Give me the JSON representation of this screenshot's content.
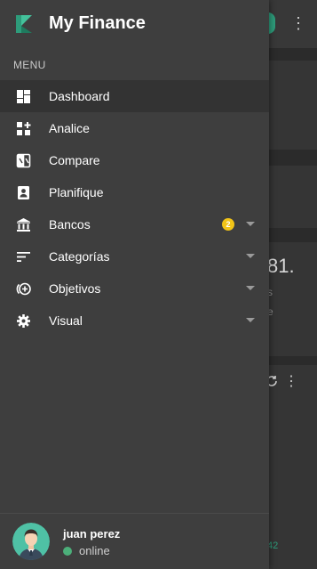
{
  "brand": {
    "title": "My Finance"
  },
  "menu": {
    "section_label": "MENU",
    "items": [
      {
        "label": "Dashboard",
        "icon": "dashboard-icon"
      },
      {
        "label": "Analice",
        "icon": "add-widget-icon"
      },
      {
        "label": "Compare",
        "icon": "compare-icon"
      },
      {
        "label": "Planifique",
        "icon": "contact-card-icon"
      },
      {
        "label": "Bancos",
        "icon": "bank-icon",
        "badge": "2"
      },
      {
        "label": "Categorías",
        "icon": "sort-icon"
      },
      {
        "label": "Objetivos",
        "icon": "add-circle-icon"
      },
      {
        "label": "Visual",
        "icon": "gear-icon"
      }
    ]
  },
  "user": {
    "name": "juan perez",
    "status": "online"
  },
  "background": {
    "number": "81.",
    "sub1": "s",
    "sub2": "e",
    "small": "42"
  },
  "colors": {
    "accent": "#2e9c7b",
    "badge": "#f2c417",
    "online": "#4caf7a"
  }
}
